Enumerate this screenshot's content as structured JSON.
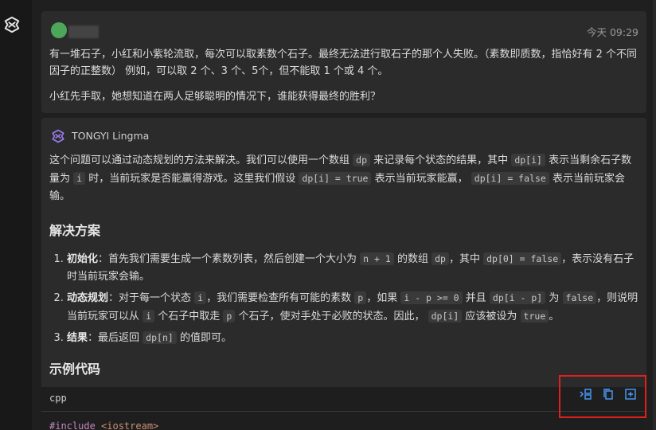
{
  "user_message": {
    "timestamp": "今天 09:29",
    "paragraph1": "有一堆石子，小红和小紫轮流取，每次可以取素数个石子。最终无法进行取石子的那个人失败。（素数即质数，指恰好有 2 个不同因子的正整数） 例如，可以取 2 个、3 个、5个，但不能取 1 个或 4 个。",
    "paragraph2": "小红先手取，她想知道在两人足够聪明的情况下，谁能获得最终的胜利？"
  },
  "ai_message": {
    "name": "TONGYI Lingma",
    "intro": {
      "t1": "这个问题可以通过动态规划的方法来解决。我们可以使用一个数组",
      "c1": "dp",
      "t2": "来记录每个状态的结果，其中",
      "c2": "dp[i]",
      "t3": "表示当剩余石子数量为",
      "c3": "i",
      "t4": "时，当前玩家是否能赢得游戏。这里我们假设",
      "c4": "dp[i] = true",
      "t5": "表示当前玩家能赢，",
      "c5": "dp[i] = false",
      "t6": "表示当前玩家会输。"
    },
    "section1_title": "解决方案",
    "steps": [
      {
        "label": "初始化",
        "t1": "：首先我们需要生成一个素数列表，然后创建一个大小为",
        "c1": "n + 1",
        "t2": "的数组",
        "c2": "dp",
        "t3": "，其中",
        "c3": "dp[0] = false",
        "t4": "，表示没有石子时当前玩家会输。"
      },
      {
        "label": "动态规划",
        "t1": "：对于每一个状态",
        "c1": "i",
        "t2": "，我们需要检查所有可能的素数",
        "c2": "p",
        "t3": "，如果",
        "c3": "i - p >= 0",
        "t4": "并且",
        "c4": "dp[i - p]",
        "t5": "为",
        "c5": "false",
        "t6": "，则说明当前玩家可以从",
        "c6": "i",
        "t7": "个石子中取走",
        "c7": "p",
        "t8": "个石子，使对手处于必败的状态。因此，",
        "c8": "dp[i]",
        "t9": "应该被设为",
        "c9": "true",
        "t10": "。"
      },
      {
        "label": "结果",
        "t1": "：最后返回",
        "c1": "dp[n]",
        "t2": "的值即可。"
      }
    ],
    "section2_title": "示例代码",
    "code": {
      "language": "cpp",
      "first_line_directive": "#include",
      "first_line_header": "<iostream>"
    }
  },
  "icons": {
    "activity_logo": "tongyi-logo-icon",
    "insert": "insert-at-cursor-icon",
    "copy": "copy-icon",
    "new_file": "new-file-icon"
  },
  "colors": {
    "highlight_border": "#e0201f",
    "accent_icon": "#4a9eff"
  }
}
